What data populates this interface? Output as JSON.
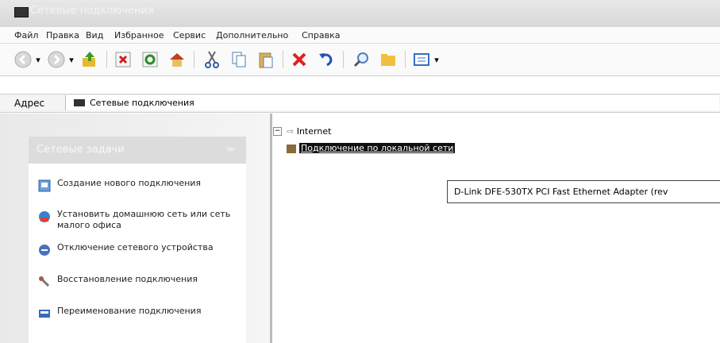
{
  "window": {
    "title": "Сетевые подключения"
  },
  "menu": [
    "Файл",
    "Правка",
    "Вид",
    "Избранное",
    "Сервис",
    "Дополнительно",
    "Справка"
  ],
  "toolbar": {
    "buttons": [
      "back-icon",
      "forward-icon",
      "up-folder-icon",
      "stop-icon",
      "refresh-icon",
      "home-icon",
      "cut-icon",
      "copy-icon",
      "paste-icon",
      "delete-icon",
      "undo-icon",
      "search-icon",
      "folders-icon",
      "views-icon"
    ]
  },
  "address": {
    "label": "Адрес",
    "value": "Сетевые подключения"
  },
  "tasks": {
    "header": "Сетевые задачи",
    "items": [
      {
        "label": "Создание нового подключения",
        "icon": "new-connection-icon"
      },
      {
        "label": "Установить домашнюю сеть или сеть малого офиса",
        "icon": "home-network-icon"
      },
      {
        "label": "Отключение сетевого устройства",
        "icon": "disable-device-icon"
      },
      {
        "label": "Восстановление подключения",
        "icon": "repair-icon"
      },
      {
        "label": "Переименование подключения",
        "icon": "rename-icon"
      }
    ]
  },
  "content": {
    "group": "Internet",
    "connection": "Подключение по локальной сети",
    "tooltip": "D-Link DFE-530TX PCI Fast Ethernet Adapter (rev"
  }
}
